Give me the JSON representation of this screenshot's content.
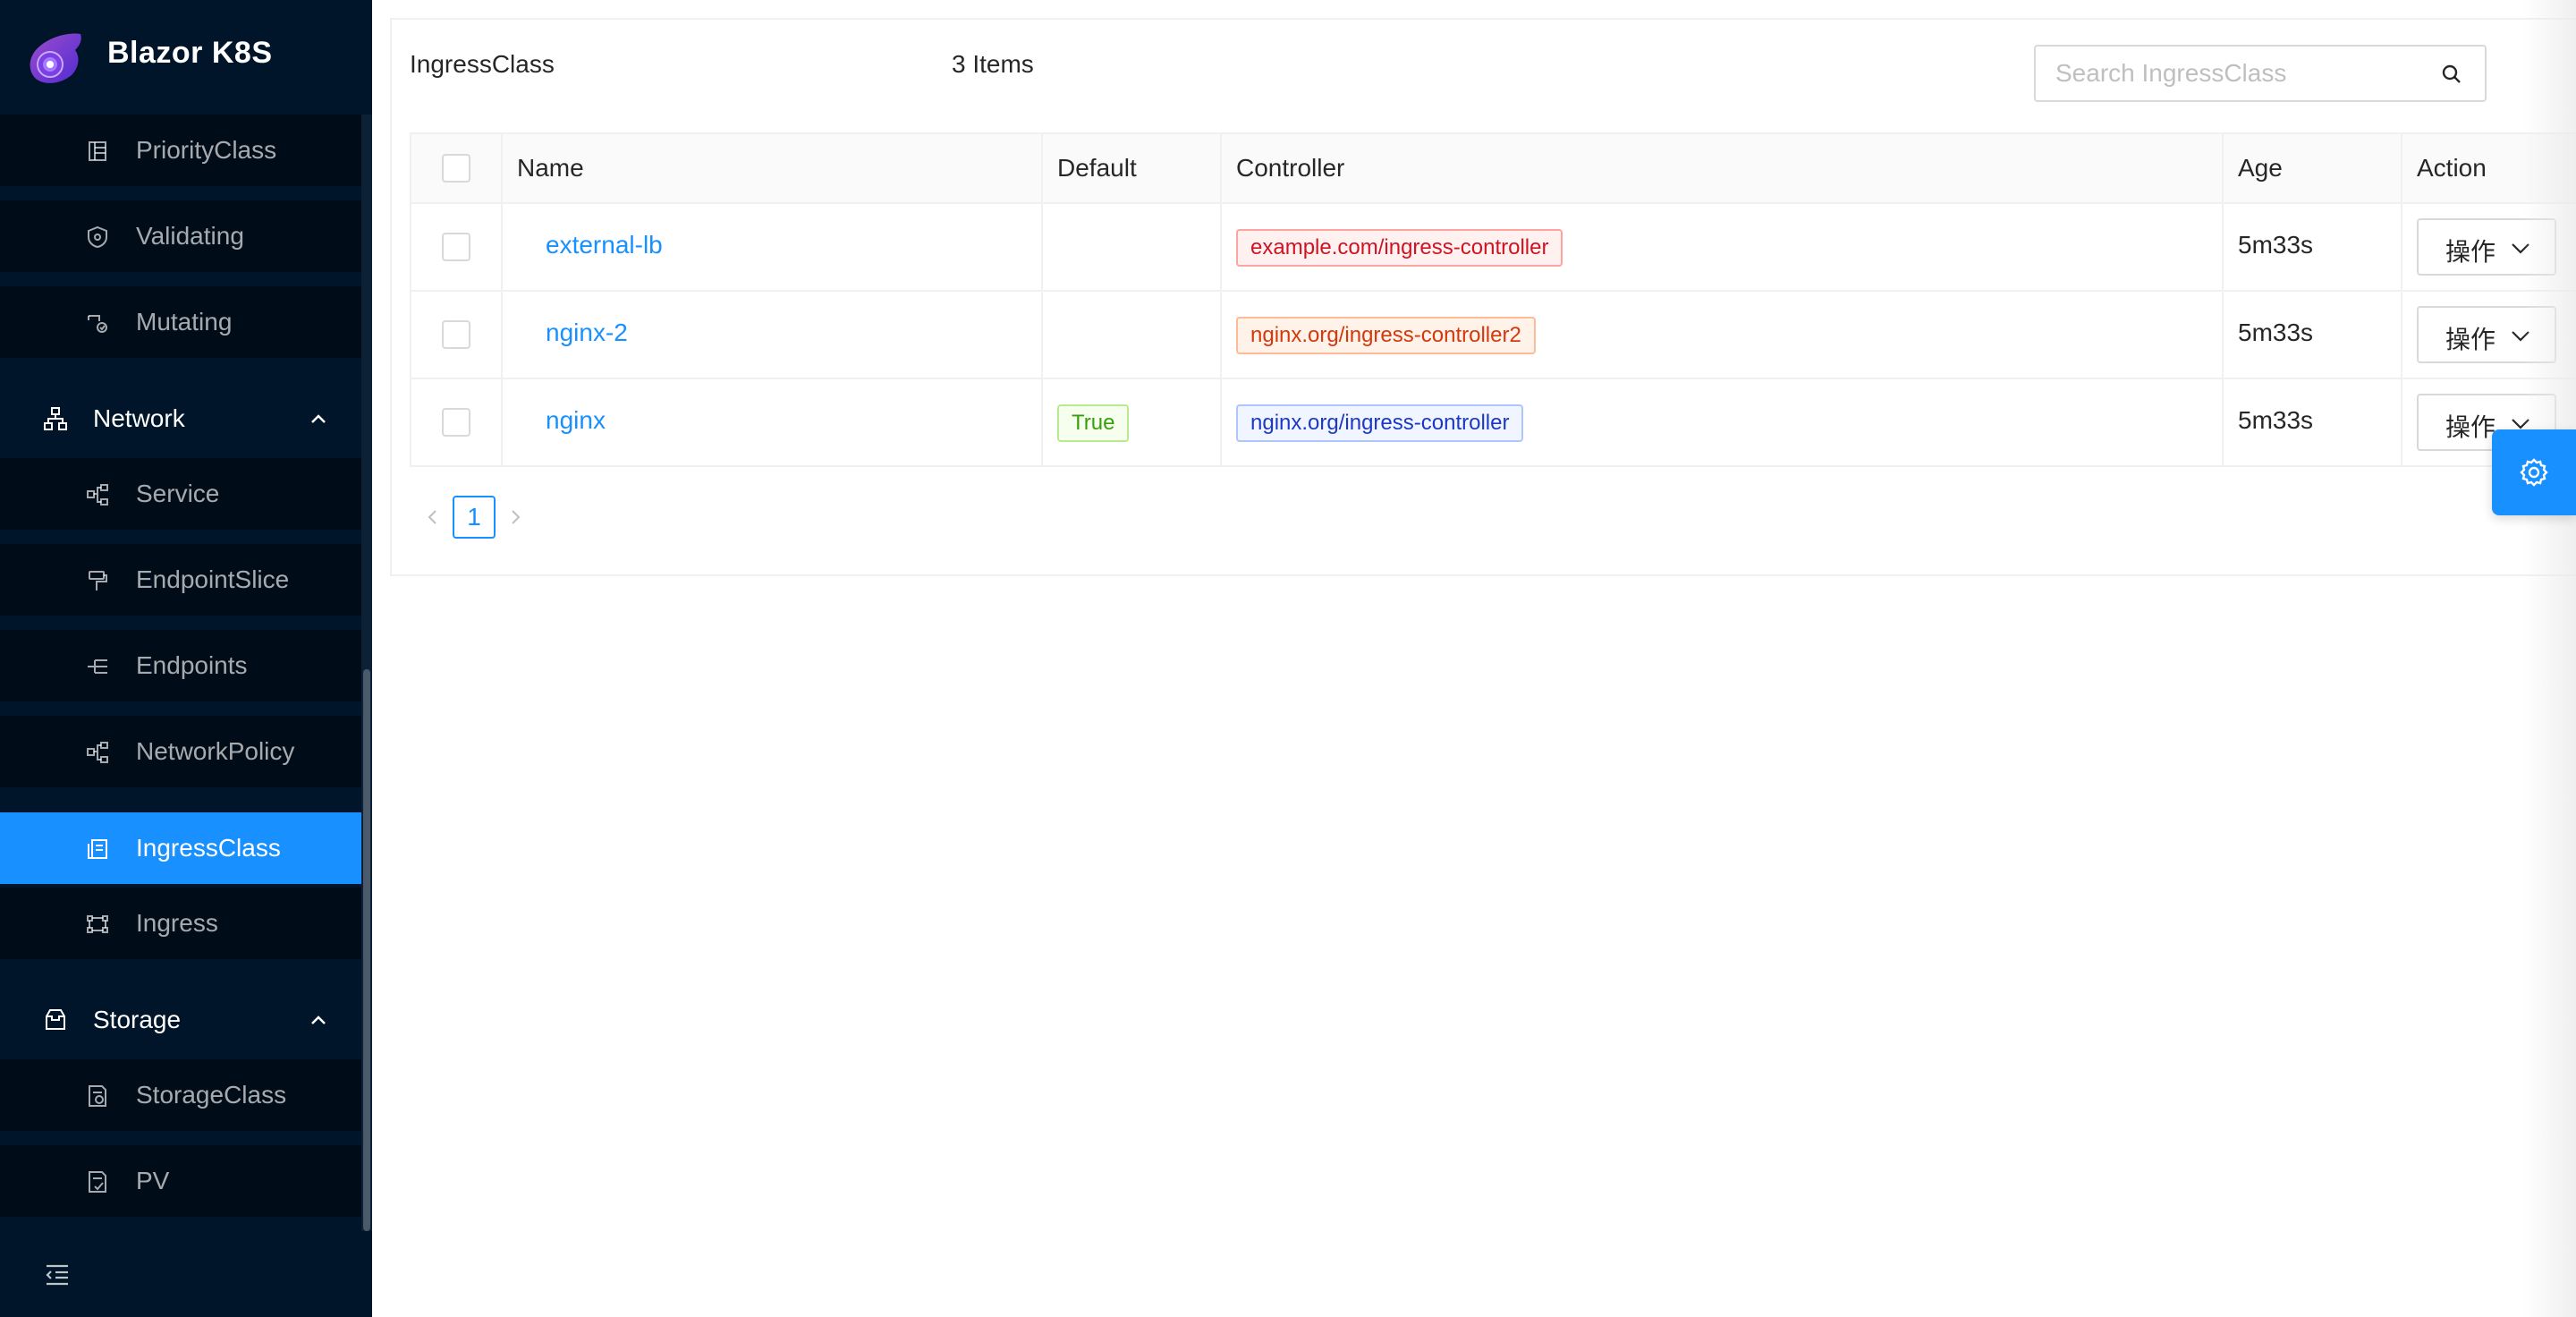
{
  "brand": {
    "title": "Blazor K8S",
    "logo_icon": "blazor-logo-icon"
  },
  "sidebar": {
    "items": [
      {
        "label": "PriorityClass",
        "icon": "priority-class-icon"
      },
      {
        "label": "Validating",
        "icon": "validating-icon"
      },
      {
        "label": "Mutating",
        "icon": "mutating-icon"
      }
    ],
    "network": {
      "label": "Network",
      "icon": "network-icon",
      "expanded": true,
      "items": [
        {
          "label": "Service",
          "icon": "service-icon"
        },
        {
          "label": "EndpointSlice",
          "icon": "endpoint-slice-icon"
        },
        {
          "label": "Endpoints",
          "icon": "endpoints-icon"
        },
        {
          "label": "NetworkPolicy",
          "icon": "network-policy-icon"
        },
        {
          "label": "IngressClass",
          "icon": "ingress-class-icon",
          "active": true
        },
        {
          "label": "Ingress",
          "icon": "ingress-icon"
        }
      ]
    },
    "storage": {
      "label": "Storage",
      "icon": "storage-icon",
      "expanded": true,
      "items": [
        {
          "label": "StorageClass",
          "icon": "storage-class-icon"
        },
        {
          "label": "PV",
          "icon": "pv-icon"
        }
      ]
    },
    "collapse_icon": "menu-fold-icon"
  },
  "main": {
    "title": "IngressClass",
    "count": "3 Items",
    "search": {
      "placeholder": "Search IngressClass",
      "value": "",
      "icon": "search-icon"
    },
    "table": {
      "columns": [
        "Name",
        "Default",
        "Controller",
        "Age",
        "Action"
      ],
      "rows": [
        {
          "name": "external-lb",
          "default": "",
          "controller": "example.com/ingress-controller",
          "controller_color": "red",
          "age": "5m33s",
          "action": "操作"
        },
        {
          "name": "nginx-2",
          "default": "",
          "controller": "nginx.org/ingress-controller2",
          "controller_color": "orange",
          "age": "5m33s",
          "action": "操作"
        },
        {
          "name": "nginx",
          "default": "True",
          "controller": "nginx.org/ingress-controller",
          "controller_color": "blue",
          "age": "5m33s",
          "action": "操作"
        }
      ]
    },
    "pagination": {
      "current": "1"
    }
  },
  "settings_fab": {
    "icon": "gear-icon"
  },
  "colors": {
    "sidebar_bg": "#001529",
    "submenu_bg": "#000c17",
    "primary": "#1890ff"
  }
}
